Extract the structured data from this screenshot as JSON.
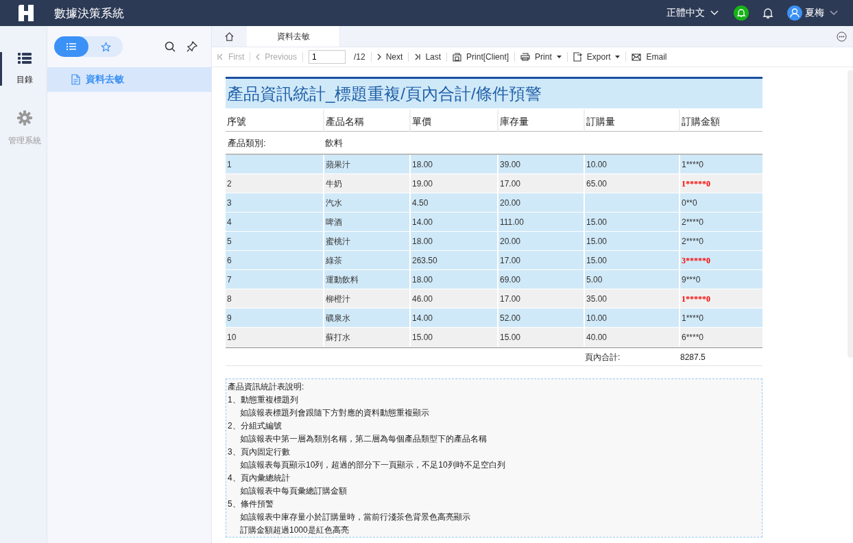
{
  "header": {
    "title": "數據決策系統",
    "language": "正體中文",
    "user": "夏梅"
  },
  "rail": [
    {
      "label": "目錄",
      "kind": "list",
      "selected": true
    },
    {
      "label": "管理系統",
      "kind": "gear",
      "selected": false
    }
  ],
  "sidebar": {
    "toggle": [
      {
        "kind": "list",
        "selected": true
      },
      {
        "kind": "star",
        "selected": false
      }
    ],
    "items": [
      {
        "label": "資料去敏",
        "selected": true
      }
    ]
  },
  "tabs": [
    {
      "label": "資料去敏",
      "selected": true
    }
  ],
  "toolbar": {
    "items": [
      {
        "kind": "first",
        "label": "First",
        "disabled": true
      },
      {
        "kind": "prev",
        "label": "Previous",
        "disabled": true
      },
      {
        "kind": "page",
        "value": "1",
        "total": "/12"
      },
      {
        "kind": "next",
        "label": "Next",
        "disabled": false
      },
      {
        "kind": "last",
        "label": "Last",
        "disabled": false
      },
      {
        "kind": "printclient",
        "label": "Print[Client]",
        "disabled": false
      },
      {
        "kind": "print",
        "label": "Print",
        "disabled": false
      },
      {
        "kind": "export",
        "label": "Export",
        "disabled": false
      },
      {
        "kind": "email",
        "label": "Email",
        "disabled": false
      }
    ]
  },
  "report": {
    "title": "產品資訊統計_標題重複/頁內合計/條件預警",
    "columns": [
      "序號",
      "產品名稱",
      "單價",
      "庫存量",
      "訂購量",
      "訂購金額"
    ],
    "category_label": "產品類別:",
    "category": "飲料",
    "rows": [
      {
        "cells": [
          "1",
          "蘋果汁",
          "18.00",
          "39.00",
          "10.00",
          "1****0"
        ],
        "highlight": false,
        "amount_alert": false
      },
      {
        "cells": [
          "2",
          "牛奶",
          "19.00",
          "17.00",
          "65.00",
          "1*****0"
        ],
        "highlight": true,
        "amount_alert": true
      },
      {
        "cells": [
          "3",
          "汽水",
          "4.50",
          "20.00",
          "",
          "0**0"
        ],
        "highlight": false,
        "amount_alert": false
      },
      {
        "cells": [
          "4",
          "啤酒",
          "14.00",
          "111.00",
          "15.00",
          "2****0"
        ],
        "highlight": false,
        "amount_alert": false
      },
      {
        "cells": [
          "5",
          "蜜桃汁",
          "18.00",
          "20.00",
          "15.00",
          "2****0"
        ],
        "highlight": false,
        "amount_alert": false
      },
      {
        "cells": [
          "6",
          "綠茶",
          "263.50",
          "17.00",
          "15.00",
          "3*****0"
        ],
        "highlight": false,
        "amount_alert": true
      },
      {
        "cells": [
          "7",
          "運動飲料",
          "18.00",
          "69.00",
          "5.00",
          "9***0"
        ],
        "highlight": false,
        "amount_alert": false
      },
      {
        "cells": [
          "8",
          "柳橙汁",
          "46.00",
          "17.00",
          "35.00",
          "1*****0"
        ],
        "highlight": true,
        "amount_alert": true
      },
      {
        "cells": [
          "9",
          "礦泉水",
          "14.00",
          "52.00",
          "10.00",
          "1****0"
        ],
        "highlight": false,
        "amount_alert": false
      },
      {
        "cells": [
          "10",
          "蘇打水",
          "15.00",
          "15.00",
          "40.00",
          "6****0"
        ],
        "highlight": true,
        "amount_alert": false
      }
    ],
    "total_label": "頁內合計:",
    "total": "8287.5"
  },
  "notes": {
    "title": "產品資訊統計表說明:",
    "sections": [
      {
        "heading": "1、動態重複標題列",
        "details": [
          "如該報表標題列會跟隨下方對應的資料動態重複顯示"
        ]
      },
      {
        "heading": "2、分組式編號",
        "details": [
          "如該報表中第一層為類別名稱，第二層為每個產品類型下的產品名稱"
        ]
      },
      {
        "heading": "3、頁內固定行數",
        "details": [
          "如該報表每頁顯示10列，超過的部分下一頁顯示，不足10列時不足空白列"
        ]
      },
      {
        "heading": "4、頁內彙總統計",
        "details": [
          "如該報表中每頁彙總訂購金額"
        ]
      },
      {
        "heading": "5、條件預警",
        "details": [
          "如該報表中庫存量小於訂購量時，當前行淺茶色背景色高亮顯示",
          "訂購金額超過1000是紅色高亮"
        ]
      }
    ]
  }
}
